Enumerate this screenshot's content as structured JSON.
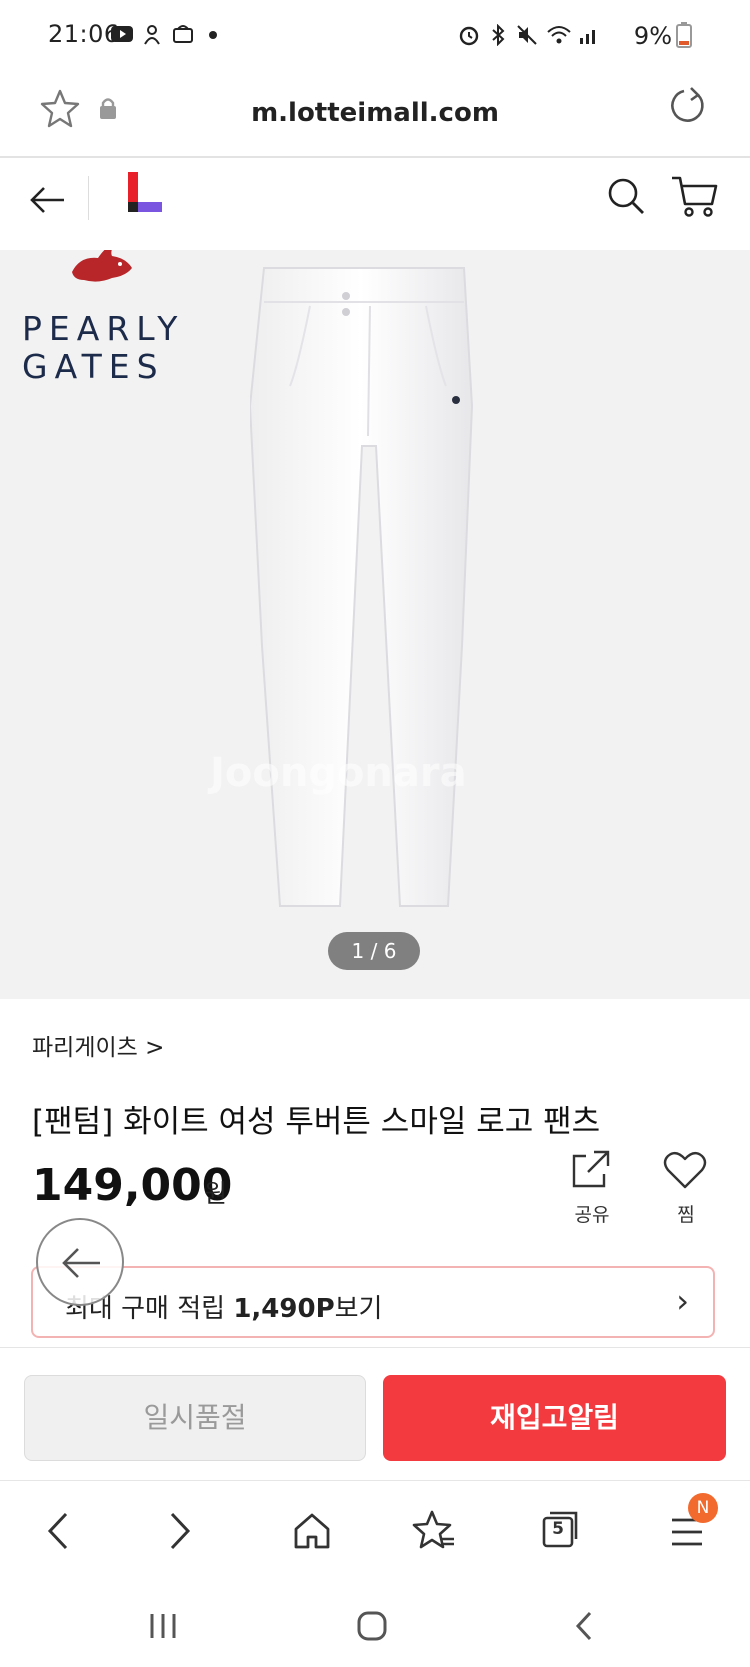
{
  "status_bar": {
    "time": "21:06",
    "battery": "9%",
    "left_icons": [
      "youtube-icon",
      "app-icon",
      "shop-icon",
      "dot-icon"
    ],
    "right_icons": [
      "alarm-icon",
      "bluetooth-icon",
      "mute-icon",
      "wifi-icon",
      "signal-icon",
      "battery-icon"
    ]
  },
  "browser": {
    "url": "m.lotteimall.com"
  },
  "product_image": {
    "brand_logo_line1": "PEARLY",
    "brand_logo_line2": "GATES",
    "counter": "1 / 6",
    "watermark": "Joongonara"
  },
  "product": {
    "brand_link": "파리게이츠 >",
    "title": "[팬텀] 화이트 여성 투버튼 스마일 로고 팬츠",
    "price": "149,000",
    "price_unit": "원",
    "share_label": "공유",
    "wish_label": "찜"
  },
  "points": {
    "prefix": "최대 구매 적립 ",
    "amount": "1,490P",
    "suffix": "보기",
    "chevron": "›"
  },
  "purchase_bar": {
    "soldout_label": "일시품절",
    "restock_label": "재입고알림"
  },
  "browser_nav": {
    "tab_count": "5",
    "menu_badge": "N"
  },
  "colors": {
    "accent_red": "#f23a3f",
    "logo_red": "#e8202a",
    "logo_purple": "#7a55e0",
    "badge_orange": "#f26a2e"
  }
}
